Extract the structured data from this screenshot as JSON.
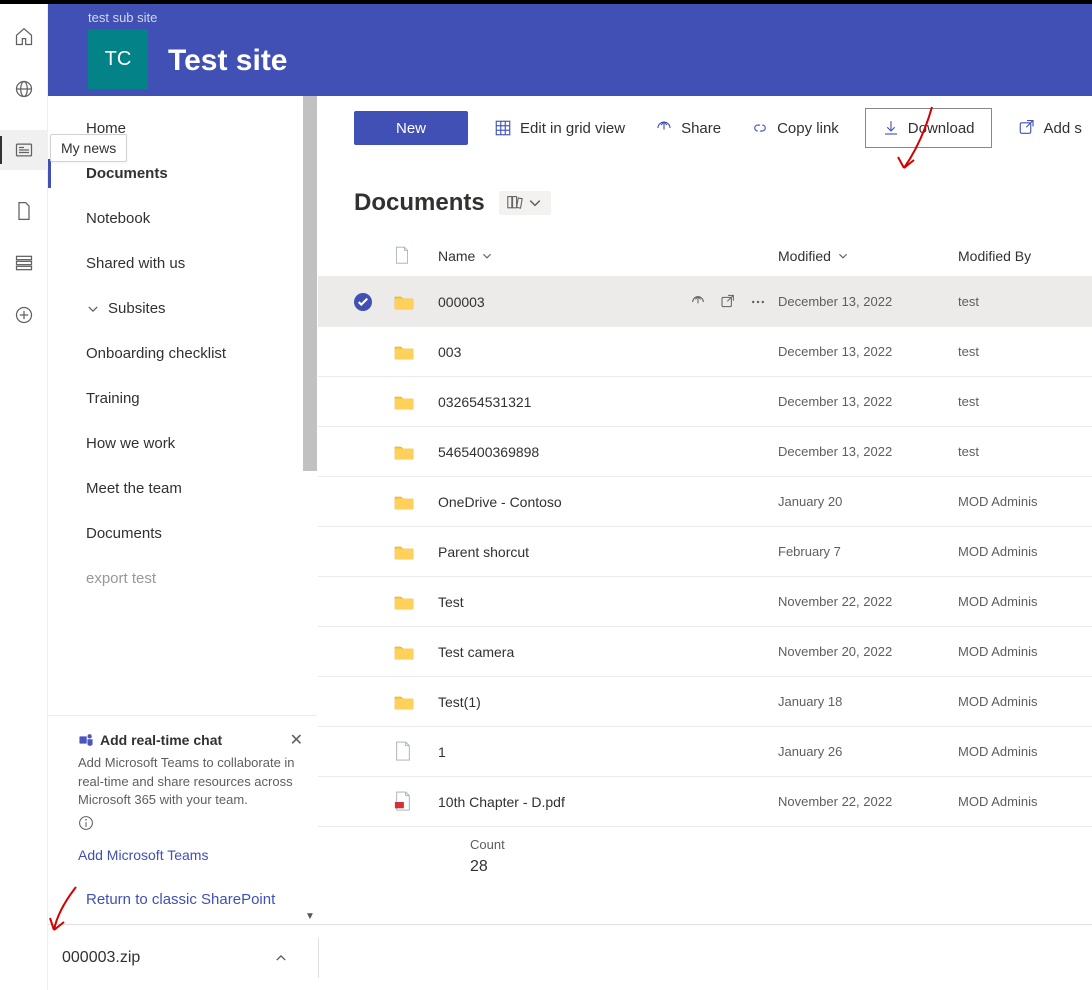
{
  "header": {
    "parent_site": "test sub site",
    "logo_initials": "TC",
    "site_title": "Test site"
  },
  "mynews_tooltip": "My news",
  "sidenav": {
    "items": [
      {
        "label": "Home"
      },
      {
        "label": "Documents",
        "active": true
      },
      {
        "label": "Notebook"
      },
      {
        "label": "Shared with us"
      },
      {
        "label": "Subsites",
        "expandable": true
      },
      {
        "label": "Onboarding checklist"
      },
      {
        "label": "Training"
      },
      {
        "label": "How we work"
      },
      {
        "label": "Meet the team"
      },
      {
        "label": "Documents"
      }
    ],
    "truncated": "export test"
  },
  "promo": {
    "title": "Add real-time chat",
    "text": "Add Microsoft Teams to collaborate in real-time and share resources across Microsoft 365 with your team.",
    "link": "Add Microsoft Teams"
  },
  "return_classic": "Return to classic SharePoint",
  "commandbar": {
    "new": "New",
    "edit_grid": "Edit in grid view",
    "share": "Share",
    "copy_link": "Copy link",
    "download": "Download",
    "add_shortcut": "Add s"
  },
  "library": {
    "title": "Documents",
    "columns": {
      "name": "Name",
      "modified": "Modified",
      "modified_by": "Modified By"
    },
    "rows": [
      {
        "type": "folder",
        "name": "000003",
        "modified": "December 13, 2022",
        "by": "test",
        "selected": true
      },
      {
        "type": "folder",
        "name": "003",
        "modified": "December 13, 2022",
        "by": "test"
      },
      {
        "type": "folder",
        "name": "032654531321",
        "modified": "December 13, 2022",
        "by": "test"
      },
      {
        "type": "folder",
        "name": "5465400369898",
        "modified": "December 13, 2022",
        "by": "test"
      },
      {
        "type": "folder",
        "name": "OneDrive - Contoso",
        "modified": "January 20",
        "by": "MOD Adminis"
      },
      {
        "type": "folder",
        "name": "Parent shorcut",
        "modified": "February 7",
        "by": "MOD Adminis"
      },
      {
        "type": "folder",
        "name": "Test",
        "modified": "November 22, 2022",
        "by": "MOD Adminis"
      },
      {
        "type": "folder",
        "name": "Test camera",
        "modified": "November 20, 2022",
        "by": "MOD Adminis"
      },
      {
        "type": "folder",
        "name": "Test(1)",
        "modified": "January 18",
        "by": "MOD Adminis"
      },
      {
        "type": "file",
        "name": "1",
        "modified": "January 26",
        "by": "MOD Adminis"
      },
      {
        "type": "pdf",
        "name": "10th Chapter - D.pdf",
        "modified": "November 22, 2022",
        "by": "MOD Adminis"
      }
    ],
    "count_label": "Count",
    "count_value": "28"
  },
  "downloadbar": {
    "filename": "000003.zip"
  }
}
